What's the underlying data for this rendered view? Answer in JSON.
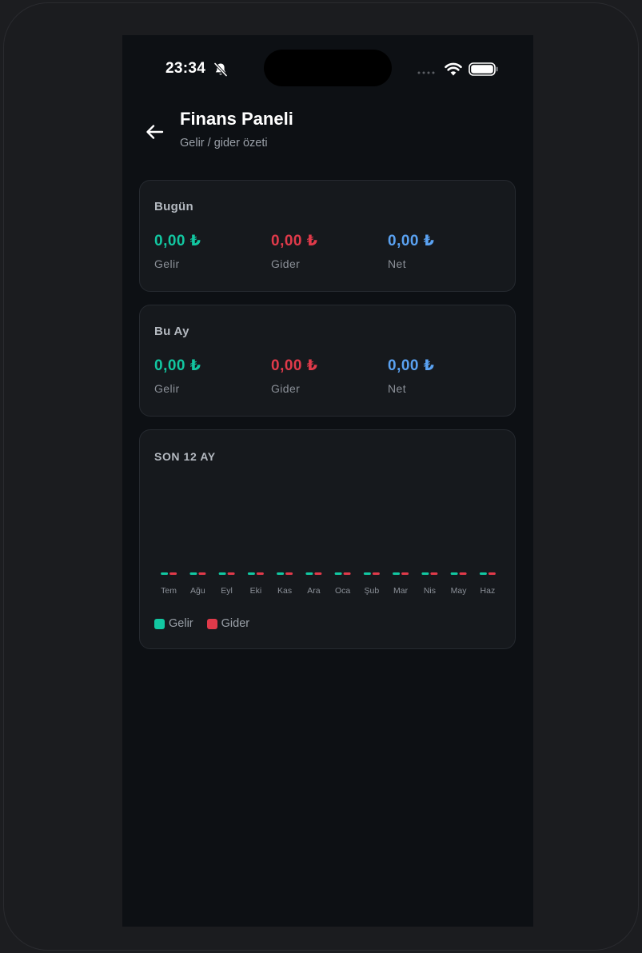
{
  "status_bar": {
    "time": "23:34"
  },
  "header": {
    "title": "Finans Paneli",
    "subtitle": "Gelir / gider özeti"
  },
  "colors": {
    "income": "#12c7a1",
    "expense": "#e03a4a",
    "net": "#5aa2f2"
  },
  "today": {
    "title": "Bugün",
    "income_value": "0,00 ₺",
    "income_label": "Gelir",
    "expense_value": "0,00 ₺",
    "expense_label": "Gider",
    "net_value": "0,00 ₺",
    "net_label": "Net"
  },
  "month": {
    "title": "Bu Ay",
    "income_value": "0,00 ₺",
    "income_label": "Gelir",
    "expense_value": "0,00 ₺",
    "expense_label": "Gider",
    "net_value": "0,00 ₺",
    "net_label": "Net"
  },
  "chart_card": {
    "title": "SON 12 AY"
  },
  "chart_data": {
    "type": "bar",
    "categories": [
      "Tem",
      "Ağu",
      "Eyl",
      "Eki",
      "Kas",
      "Ara",
      "Oca",
      "Şub",
      "Mar",
      "Nis",
      "May",
      "Haz"
    ],
    "series": [
      {
        "name": "Gelir",
        "color": "#12c7a1",
        "values": [
          0,
          0,
          0,
          0,
          0,
          0,
          0,
          0,
          0,
          0,
          0,
          0
        ]
      },
      {
        "name": "Gider",
        "color": "#e03a4a",
        "values": [
          0,
          0,
          0,
          0,
          0,
          0,
          0,
          0,
          0,
          0,
          0,
          0
        ]
      }
    ],
    "grid": false,
    "legend_position": "bottom-left"
  },
  "legend": [
    {
      "label": "Gelir",
      "color": "#12c7a1"
    },
    {
      "label": "Gider",
      "color": "#e03a4a"
    }
  ]
}
